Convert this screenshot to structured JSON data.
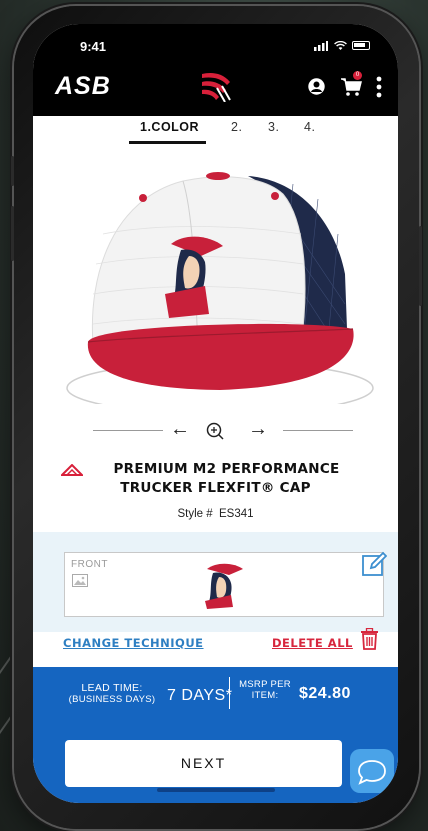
{
  "status_bar": {
    "time": "9:41"
  },
  "header": {
    "logo_text": "ASB",
    "brand_icon": "brand-stripes-icon",
    "cart_count": "0",
    "accent_color": "#d8203a"
  },
  "steps": [
    {
      "label": "1.COLOR",
      "active": true
    },
    {
      "label": "2.",
      "active": false
    },
    {
      "label": "3.",
      "active": false
    },
    {
      "label": "4.",
      "active": false
    }
  ],
  "viewer": {
    "rotate_left_icon": "arrow-left-icon",
    "zoom_icon": "zoom-in-icon",
    "rotate_right_icon": "arrow-right-icon"
  },
  "product": {
    "title_line1": "PREMIUM M2 PERFORMANCE",
    "title_line2": "TRUCKER FLEXFIT® CAP",
    "style_label": "Style #",
    "style_number": "ES341",
    "colors": {
      "crown": "#f2f2f2",
      "bill": "#c8203a",
      "mesh": "#1f2a4a"
    }
  },
  "decoration": {
    "location_label": "FRONT",
    "change_technique": "CHANGE TECHNIQUE",
    "delete_all": "DELETE ALL"
  },
  "footer": {
    "lead_time_label": "LEAD TIME:",
    "lead_time_sub": "(BUSINESS DAYS)",
    "lead_time_value": "7  DAYS*",
    "msrp_label_1": "MSRP PER",
    "msrp_label_2": "ITEM:",
    "msrp_value": "$24.80",
    "next_label": "NEXT",
    "primary_color": "#1565c0",
    "chat_icon": "chat-bubble-icon"
  }
}
